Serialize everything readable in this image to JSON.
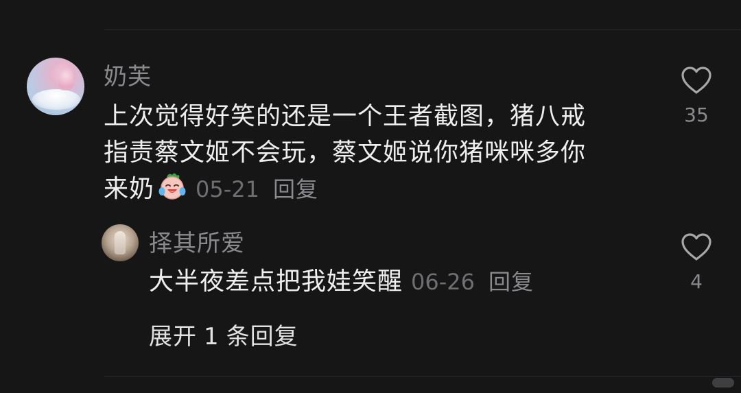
{
  "comment": {
    "username": "奶芙",
    "text_lines": [
      "上次觉得好笑的还是一个王者截图，猪八戒",
      "指责蔡文姬不会玩，蔡文姬说你猪咪咪多你",
      "来奶"
    ],
    "emoji": "laughing-crying-emoji",
    "date": "05-21",
    "reply_label": "回复",
    "like_count": "35"
  },
  "reply": {
    "username": "择其所爱",
    "text": "大半夜差点把我娃笑醒",
    "date": "06-26",
    "reply_label": "回复",
    "like_count": "4"
  },
  "expand": {
    "prefix": "展开",
    "count": "1",
    "suffix": "条回复"
  },
  "colors": {
    "background": "#161617",
    "text": "#eeeeee",
    "muted": "#8a8a8e"
  }
}
